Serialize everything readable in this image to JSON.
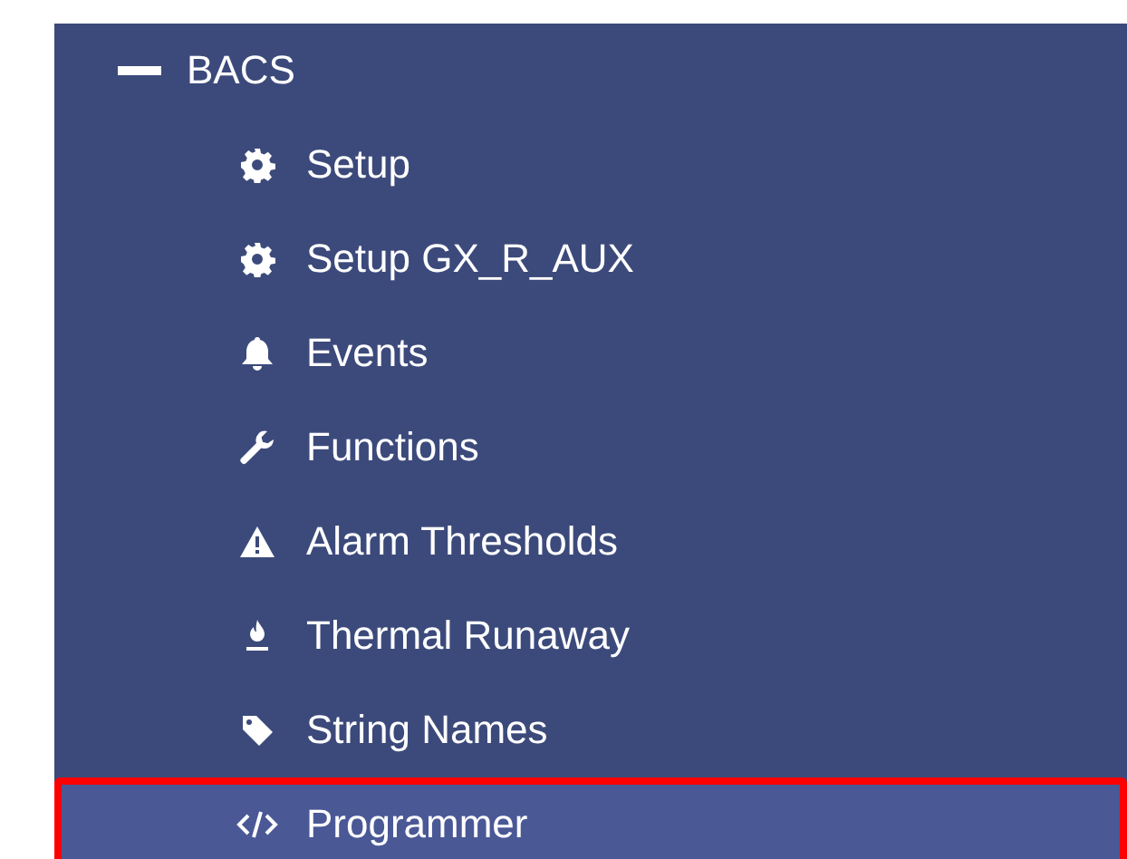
{
  "tree": {
    "label": "BACS",
    "expanded": true,
    "children": [
      {
        "label": "Setup",
        "selected": false
      },
      {
        "label": "Setup GX_R_AUX",
        "selected": false
      },
      {
        "label": "Events",
        "selected": false
      },
      {
        "label": "Functions",
        "selected": false
      },
      {
        "label": "Alarm Thresholds",
        "selected": false
      },
      {
        "label": "Thermal Runaway",
        "selected": false
      },
      {
        "label": "String Names",
        "selected": false
      },
      {
        "label": "Programmer",
        "selected": true
      }
    ]
  }
}
